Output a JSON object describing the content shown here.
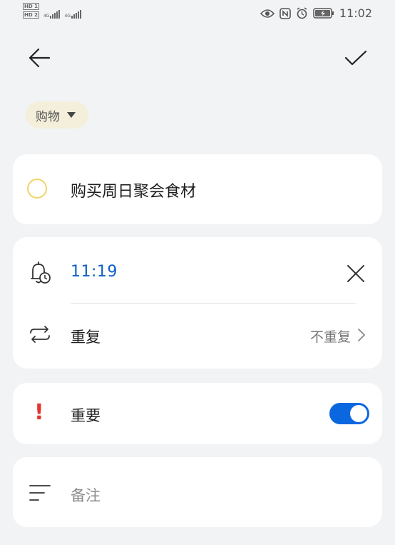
{
  "status_bar": {
    "sim1": "HD 1",
    "sim2": "HD 2",
    "net1": "4G",
    "net2": "4G",
    "time": "11:02"
  },
  "header": {
    "back_icon": "arrow-left-icon",
    "done_icon": "checkmark-icon"
  },
  "category": {
    "label": "购物"
  },
  "task": {
    "title": "购买周日聚会食材"
  },
  "reminder": {
    "time": "11:19",
    "repeat_label": "重复",
    "repeat_value": "不重复"
  },
  "important": {
    "label": "重要",
    "enabled": true,
    "icon_color": "#e3342f",
    "toggle_color": "#0b67e0"
  },
  "note": {
    "placeholder": "备注"
  },
  "colors": {
    "accent": "#0c5fc9",
    "checkbox_ring": "#f2d36b",
    "chip_bg": "#f3efdb",
    "page_bg": "#f1f3f5"
  }
}
